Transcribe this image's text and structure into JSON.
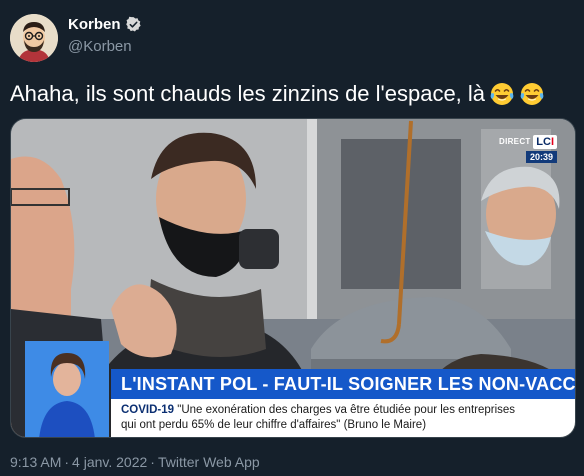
{
  "author": {
    "display_name": "Korben",
    "handle": "@Korben",
    "verified_icon": "verified-badge-icon",
    "avatar_icon": "cartoon-avatar"
  },
  "tweet": {
    "text": "Ahaha, ils sont chauds les zinzins de l'espace, là",
    "emojis": [
      "face-with-tears-of-joy",
      "face-with-tears-of-joy"
    ]
  },
  "media": {
    "channel": {
      "direct": "DIRECT",
      "logo_left": "LC",
      "logo_right": "I",
      "time": "20:39"
    },
    "lower_third": {
      "title": "L'INSTANT POL - FAUT-IL SOIGNER LES NON-VACCINÉS ?",
      "tag": "COVID-19",
      "quote_line1": "\"Une exonération des charges va être étudiée pour les entreprises",
      "quote_line2": "qui ont perdu 65% de leur chiffre d'affaires\" (Bruno le Maire)"
    }
  },
  "footer": {
    "time": "9:13 AM",
    "separator": "·",
    "date": "4 janv. 2022",
    "source": "Twitter Web App"
  },
  "colors": {
    "background": "#15202b",
    "secondary_text": "#8b98a5",
    "verified": "#d9d9d9",
    "news_blue": "#1558c9"
  }
}
